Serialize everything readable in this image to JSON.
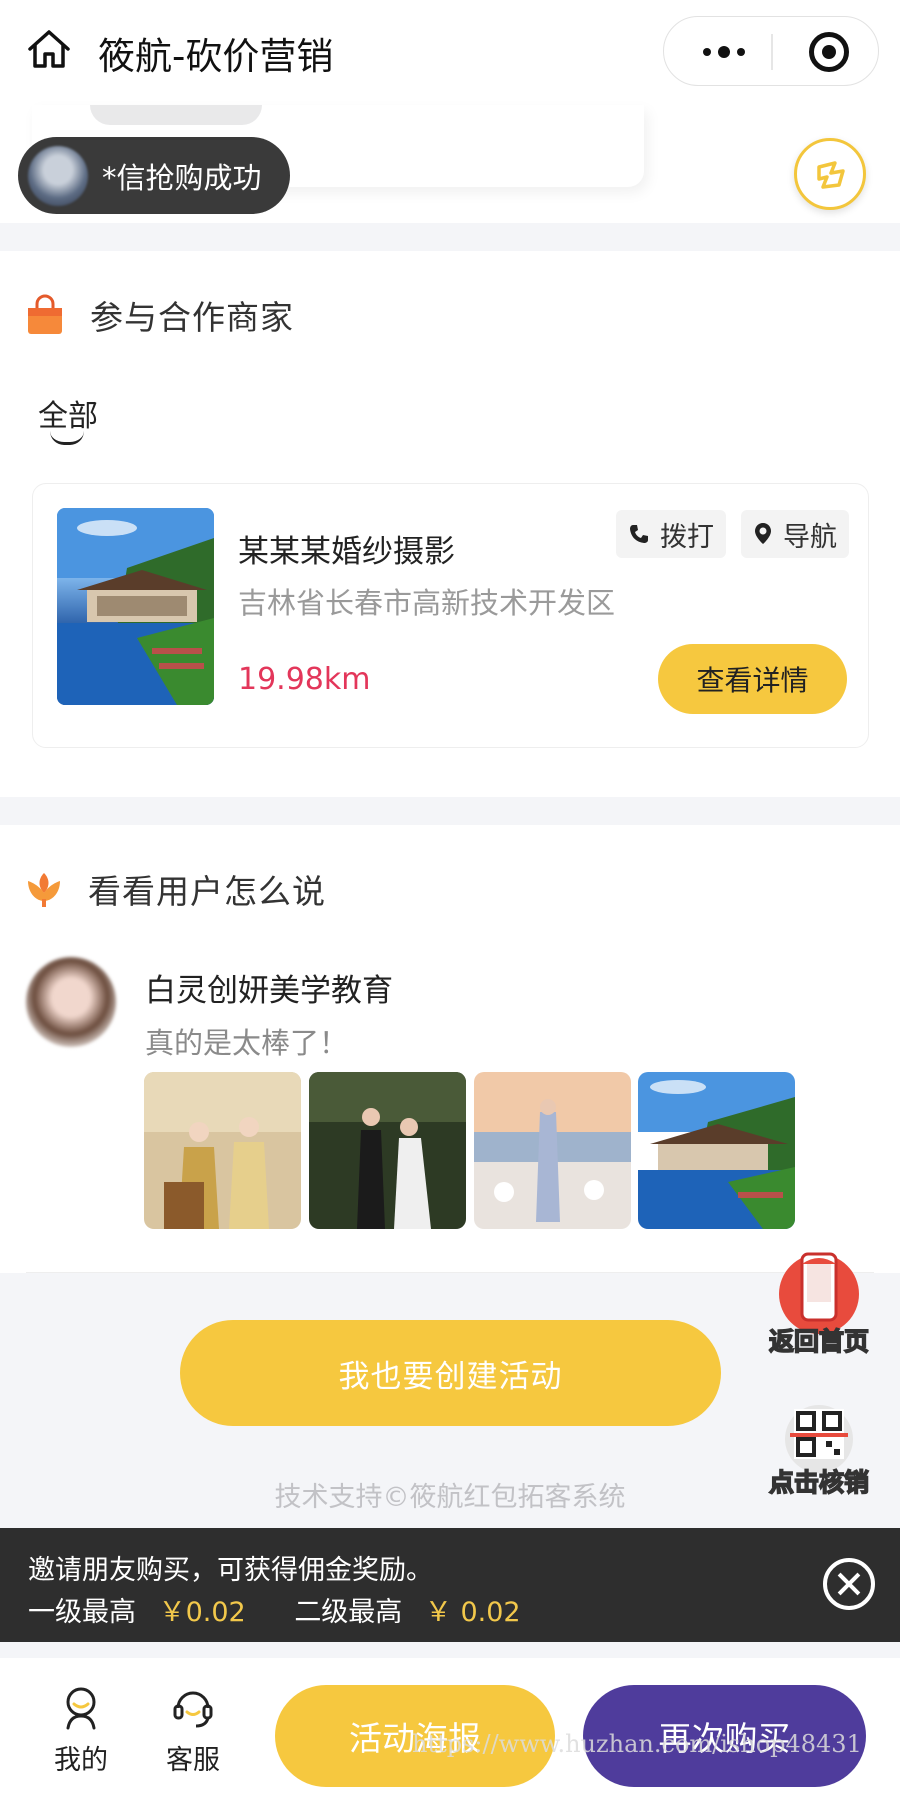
{
  "header": {
    "title": "筱航-砍价营销"
  },
  "toast": {
    "text": "*信抢购成功"
  },
  "merchants": {
    "section_title": "参与合作商家",
    "tab_all": "全部",
    "card": {
      "name": "某某某婚纱摄影",
      "address": "吉林省长春市高新技术开发区",
      "distance": "19.98km",
      "call_label": "拨打",
      "nav_label": "导航",
      "detail_label": "查看详情"
    }
  },
  "reviews": {
    "section_title": "看看用户怎么说",
    "item": {
      "user": "白灵创妍美学教育",
      "text": "真的是太棒了！"
    }
  },
  "cta": {
    "create_label": "我也要创建活动",
    "footer": "技术支持©筱航红包拓客系统"
  },
  "floating": {
    "home_label": "返回首页",
    "verify_label": "点击核销"
  },
  "invite": {
    "line1": "邀请朋友购买，可获得佣金奖励。",
    "level1_label": "一级最高",
    "level1_value": "￥0.02",
    "level2_label": "二级最高",
    "level2_value": "￥ 0.02"
  },
  "bottom": {
    "mine_label": "我的",
    "service_label": "客服",
    "poster_label": "活动海报",
    "buy_label": "再次购买",
    "watermark": "https://www.huzhan.com/ishop48431"
  },
  "colors": {
    "accent_yellow": "#f6c83f",
    "primary_purple": "#4f3c9c",
    "distance_red": "#e3365a",
    "invite_bg": "#2e2e2e"
  }
}
